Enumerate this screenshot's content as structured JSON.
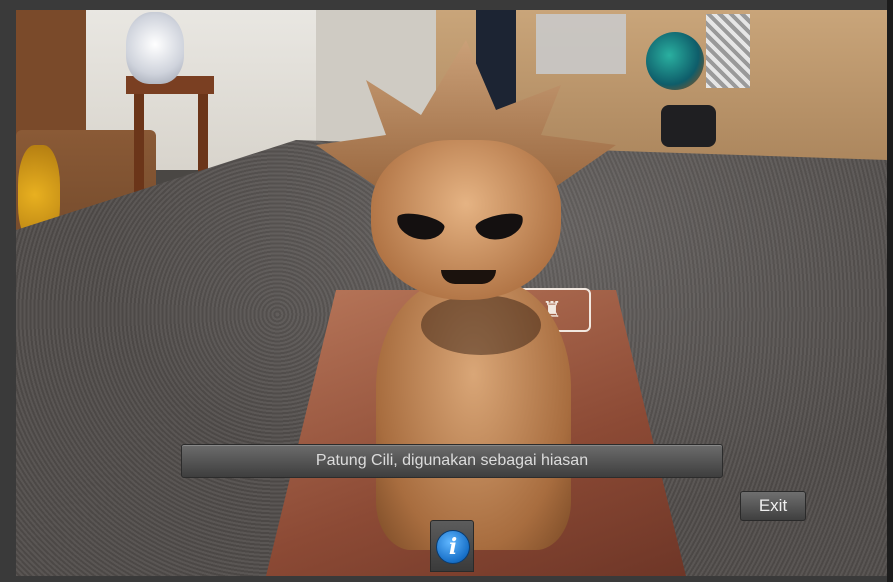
{
  "scene": {
    "caption": "Patung Cili, digunakan sebagai hiasan",
    "exit_label": "Exit",
    "info_icon": "info-icon",
    "info_glyph": "i",
    "card_logo_glyph": "♜"
  },
  "colors": {
    "caption_bar": "#4e4e4e",
    "exit_button": "#555555",
    "info_icon": "#1f7ad0"
  }
}
